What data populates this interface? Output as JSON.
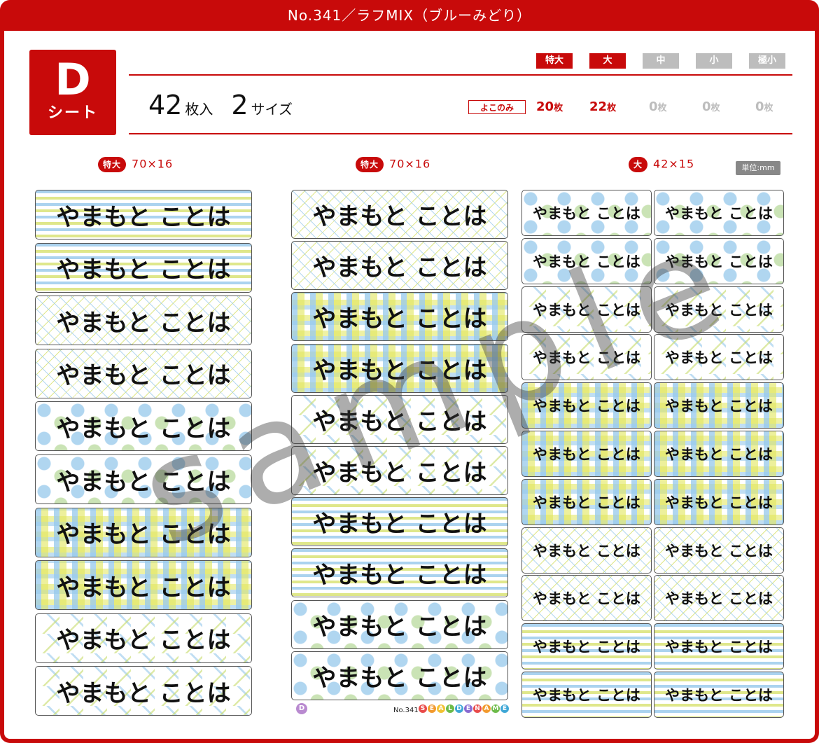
{
  "header": {
    "title": "No.341／ラフMIX（ブルーみどり）"
  },
  "sheet": {
    "letter": "D",
    "word": "シート"
  },
  "summary": {
    "count": "42",
    "count_unit": "枚入",
    "sizes": "2",
    "sizes_unit": "サイズ"
  },
  "size_tags": [
    {
      "label": "特大",
      "active": true
    },
    {
      "label": "大",
      "active": true
    },
    {
      "label": "中",
      "active": false
    },
    {
      "label": "小",
      "active": false
    },
    {
      "label": "極小",
      "active": false
    }
  ],
  "yoko_label": "よこのみ",
  "counts": [
    {
      "value": "20",
      "unit": "枚"
    },
    {
      "value": "22",
      "unit": "枚"
    },
    {
      "value": "0",
      "unit": "枚"
    },
    {
      "value": "0",
      "unit": "枚"
    },
    {
      "value": "0",
      "unit": "枚"
    }
  ],
  "columns": [
    {
      "badge": "特大",
      "dims": "70×16"
    },
    {
      "badge": "特大",
      "dims": "70×16"
    },
    {
      "badge": "大",
      "dims": "42×15"
    }
  ],
  "unit_note": "単位:mm",
  "label_text": "やまもと ことは",
  "watermark": "sample",
  "colors": {
    "brand_red": "#c80a0a",
    "inactive_gray": "#bdbdbd"
  },
  "footer": {
    "badge": "D",
    "model": "No.341",
    "logo_letters": [
      "S",
      "E",
      "A",
      "L",
      "D",
      "E",
      "N",
      "A",
      "M",
      "E"
    ]
  }
}
